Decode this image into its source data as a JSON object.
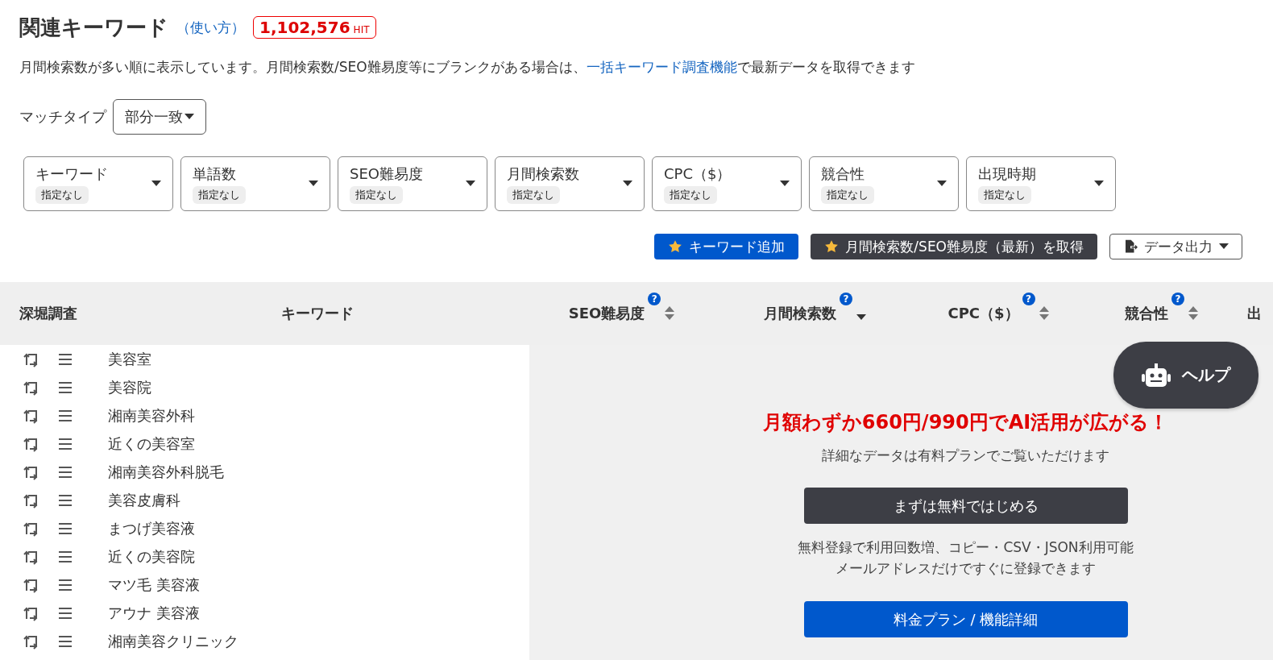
{
  "header": {
    "title": "関連キーワード",
    "help_link": "（使い方）",
    "hit_count": "1,102,576",
    "hit_unit": "HIT"
  },
  "description": {
    "text": "月間検索数が多い順に表示しています。月間検索数/SEO難易度等にブランクがある場合は、",
    "link": "一括キーワード調査機能",
    "suffix": "で最新データを取得できます"
  },
  "match_type": {
    "label": "マッチタイプ",
    "value": "部分一致"
  },
  "filters": [
    {
      "label": "キーワード",
      "value": "指定なし"
    },
    {
      "label": "単語数",
      "value": "指定なし"
    },
    {
      "label": "SEO難易度",
      "value": "指定なし"
    },
    {
      "label": "月間検索数",
      "value": "指定なし"
    },
    {
      "label": "CPC（$）",
      "value": "指定なし"
    },
    {
      "label": "競合性",
      "value": "指定なし"
    },
    {
      "label": "出現時期",
      "value": "指定なし"
    }
  ],
  "actions": [
    {
      "kind": "primary",
      "label": "キーワード追加"
    },
    {
      "kind": "dark",
      "label": "月間検索数/SEO難易度（最新）を取得"
    },
    {
      "kind": "export",
      "label": "データ出力"
    }
  ],
  "table": {
    "columns": [
      {
        "label": "深堀調査",
        "sortable": false
      },
      {
        "label": "キーワード",
        "sortable": false
      },
      {
        "label": "SEO難易度",
        "help": "?",
        "sortable": true,
        "sorted_desc": false
      },
      {
        "label": "月間検索数",
        "help": "?",
        "sortable": true,
        "sorted_desc": true
      },
      {
        "label": "CPC（$）",
        "help": "?",
        "sortable": true,
        "sorted_desc": false
      },
      {
        "label": "競合性",
        "help": "?",
        "sortable": true,
        "sorted_desc": false
      },
      {
        "label": "出",
        "sortable": false
      }
    ],
    "rows": [
      {
        "keyword": "美容室"
      },
      {
        "keyword": "美容院"
      },
      {
        "keyword": "湘南美容外科"
      },
      {
        "keyword": "近くの美容室"
      },
      {
        "keyword": "湘南美容外科脱毛"
      },
      {
        "keyword": "美容皮膚科"
      },
      {
        "keyword": "まつげ美容液"
      },
      {
        "keyword": "近くの美容院"
      },
      {
        "keyword": "マツ毛 美容液"
      },
      {
        "keyword": "アウナ 美容液"
      },
      {
        "keyword": "湘南美容クリニック"
      }
    ]
  },
  "promo": {
    "headline": "月額わずか660円/990円でAI活用が広がる！",
    "subtext": "詳細なデータは有料プランでご覧いただけます",
    "primary_button": "まずは無料ではじめる",
    "notes": [
      "無料登録で利用回数増、コピー・CSV・JSON利用可能",
      "メールアドレスだけですぐに登録できます"
    ],
    "secondary_button": "料金プラン / 機能詳細"
  },
  "help_button": {
    "label": "ヘルプ"
  }
}
